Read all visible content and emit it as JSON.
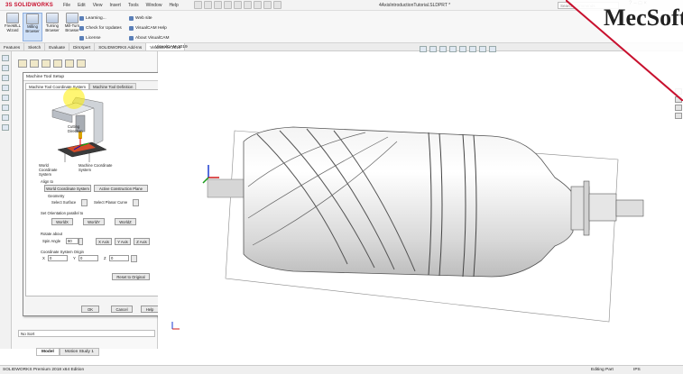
{
  "titlebar": {
    "logo": "3S SOLIDWORKS",
    "menu": [
      "File",
      "Edit",
      "View",
      "Insert",
      "Tools",
      "Window",
      "Help"
    ],
    "doc_title": "4AxisIntroductionTutorial.SLDPRT *",
    "search_placeholder": "Search Commands",
    "win_controls": [
      "?",
      "–",
      "□",
      "×"
    ]
  },
  "ribbon": {
    "buttons": [
      {
        "label": "FreeMILL Wizard"
      },
      {
        "label": "Milling Browser"
      },
      {
        "label": "Turning Browser"
      },
      {
        "label": "Mill-Turn Browser"
      }
    ],
    "links": [
      "Learning...",
      "Check for Updates",
      "License",
      "Web site",
      "VisualCAM Help",
      "About VisualCAM"
    ]
  },
  "tabs": [
    "Features",
    "Sketch",
    "Evaluate",
    "DimXpert",
    "SOLIDWORKS Add-Ins",
    "VisualCAM 2019"
  ],
  "dialog": {
    "title": "Machine Tool Setup",
    "tabs": [
      "Machine Tool Coordinate System",
      "Machine Tool Definition"
    ],
    "illustration": {
      "cutting_direction": "Cutting Direction",
      "world_cs": "World Coordinate System",
      "machine_cs": "Machine Coordinate System"
    },
    "align_to": {
      "label": "Align to",
      "world_btn": "World Coordinate System",
      "active_plane_btn": "Active Construction Plane",
      "geometry_label": "Geometry",
      "select_surface": "Select Surface",
      "select_planar": "Select Planar Curve"
    },
    "set_orientation": {
      "label": "Set Orientation parallel to",
      "buttons": [
        "WorldX",
        "WorldY",
        "WorldZ"
      ]
    },
    "rotate": {
      "label": "Rotate about",
      "spin_label": "Spin Angle",
      "spin_value": "90",
      "buttons": [
        "X Axis",
        "Y Axis",
        "Z Axis"
      ]
    },
    "origin": {
      "label": "Coordinate System Origin",
      "x_label": "X",
      "y_label": "Y",
      "z_label": "Z",
      "x": "0",
      "y": "0",
      "z": "0"
    },
    "reset_btn": "Reset to Original",
    "footer": [
      "OK",
      "Cancel",
      "Help"
    ]
  },
  "panel": {
    "sort_label": "No Sort"
  },
  "bottom_tabs": [
    "Model",
    "Motion Study 1"
  ],
  "statusbar": {
    "left": "SOLIDWORKS Premium 2018 x64 Edition",
    "mode": "Editing Part",
    "units": "IPS"
  },
  "watermark": "MecSoft",
  "colors": {
    "accent": "#c8102e",
    "ribbon_active": "#cfe0f7"
  }
}
